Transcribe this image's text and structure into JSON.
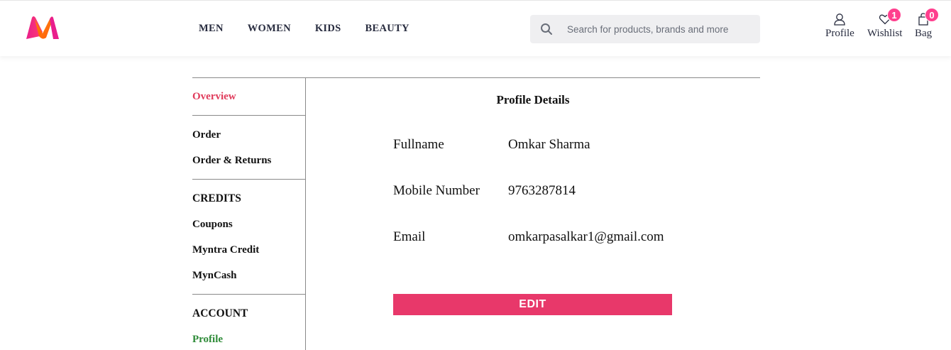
{
  "header": {
    "nav": [
      "MEN",
      "WOMEN",
      "KIDS",
      "BEAUTY"
    ],
    "search": {
      "placeholder": "Search for products, brands and more"
    },
    "actions": {
      "profile": {
        "label": "Profile",
        "icon": "user-icon"
      },
      "wishlist": {
        "label": "Wishlist",
        "icon": "heart-icon",
        "count": "1"
      },
      "bag": {
        "label": "Bag",
        "icon": "bag-icon",
        "count": "0"
      }
    },
    "brand_colors": {
      "logo_pink": "#e91e8c",
      "logo_orange": "#ff6a00",
      "badge": "#ff3f8e"
    }
  },
  "sidebar": {
    "overview": "Overview",
    "orders": [
      "Order",
      "Order & Returns"
    ],
    "credits_heading": "CREDITS",
    "credits": [
      "Coupons",
      "Myntra Credit",
      "MynCash"
    ],
    "account_heading": "ACCOUNT",
    "account": [
      "Profile"
    ],
    "colors": {
      "overview_active": "#e03a5a",
      "profile_active": "#2e8b38"
    }
  },
  "profile": {
    "title": "Profile Details",
    "fields": [
      {
        "label": "Fullname",
        "value": "Omkar Sharma"
      },
      {
        "label": "Mobile Number",
        "value": "9763287814"
      },
      {
        "label": "Email",
        "value": "omkarpasalkar1@gmail.com"
      }
    ],
    "edit_label": "EDIT",
    "edit_color": "#e8386a"
  }
}
